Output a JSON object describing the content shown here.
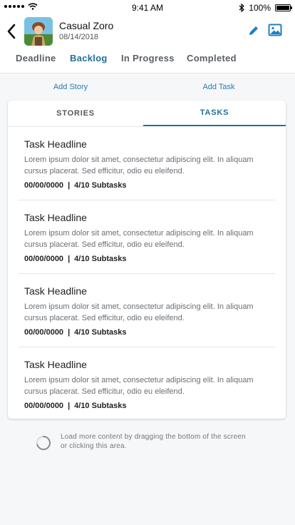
{
  "status_bar": {
    "time": "9:41 AM",
    "battery": "100%"
  },
  "header": {
    "profile_name": "Casual Zoro",
    "profile_date": "08/14/2018",
    "tabs": [
      {
        "label": "Deadline",
        "active": false
      },
      {
        "label": "Backlog",
        "active": true
      },
      {
        "label": "In Progress",
        "active": false
      },
      {
        "label": "Completed",
        "active": false
      }
    ]
  },
  "actions": {
    "add_story": "Add Story",
    "add_task": "Add Task"
  },
  "segments": {
    "stories": "STORIES",
    "tasks": "TASKS",
    "active": "TASKS"
  },
  "tasks": [
    {
      "title": "Task Headline",
      "description": "Lorem ipsum dolor sit amet, consectetur adipiscing elit. In aliquam cursus placerat. Sed efficitur, odio eu eleifend.",
      "date": "00/00/0000",
      "subtasks": "4/10 Subtasks"
    },
    {
      "title": "Task Headline",
      "description": "Lorem ipsum dolor sit amet, consectetur adipiscing elit. In aliquam cursus placerat. Sed efficitur, odio eu eleifend.",
      "date": "00/00/0000",
      "subtasks": "4/10 Subtasks"
    },
    {
      "title": "Task Headline",
      "description": "Lorem ipsum dolor sit amet, consectetur adipiscing elit. In aliquam cursus placerat. Sed efficitur, odio eu eleifend.",
      "date": "00/00/0000",
      "subtasks": "4/10 Subtasks"
    },
    {
      "title": "Task Headline",
      "description": "Lorem ipsum dolor sit amet, consectetur adipiscing elit. In aliquam cursus placerat. Sed efficitur, odio eu eleifend.",
      "date": "00/00/0000",
      "subtasks": "4/10 Subtasks"
    }
  ],
  "load_more": {
    "text": "Load more content by dragging the bottom of the screen or clicking this area."
  },
  "icons": {
    "back": "chevron-left-icon",
    "edit": "pencil-icon",
    "image": "image-icon",
    "spinner": "loading-spinner-icon"
  },
  "colors": {
    "accent": "#1f6f9e",
    "link": "#2a7bb3",
    "background": "#f6f7f9"
  }
}
